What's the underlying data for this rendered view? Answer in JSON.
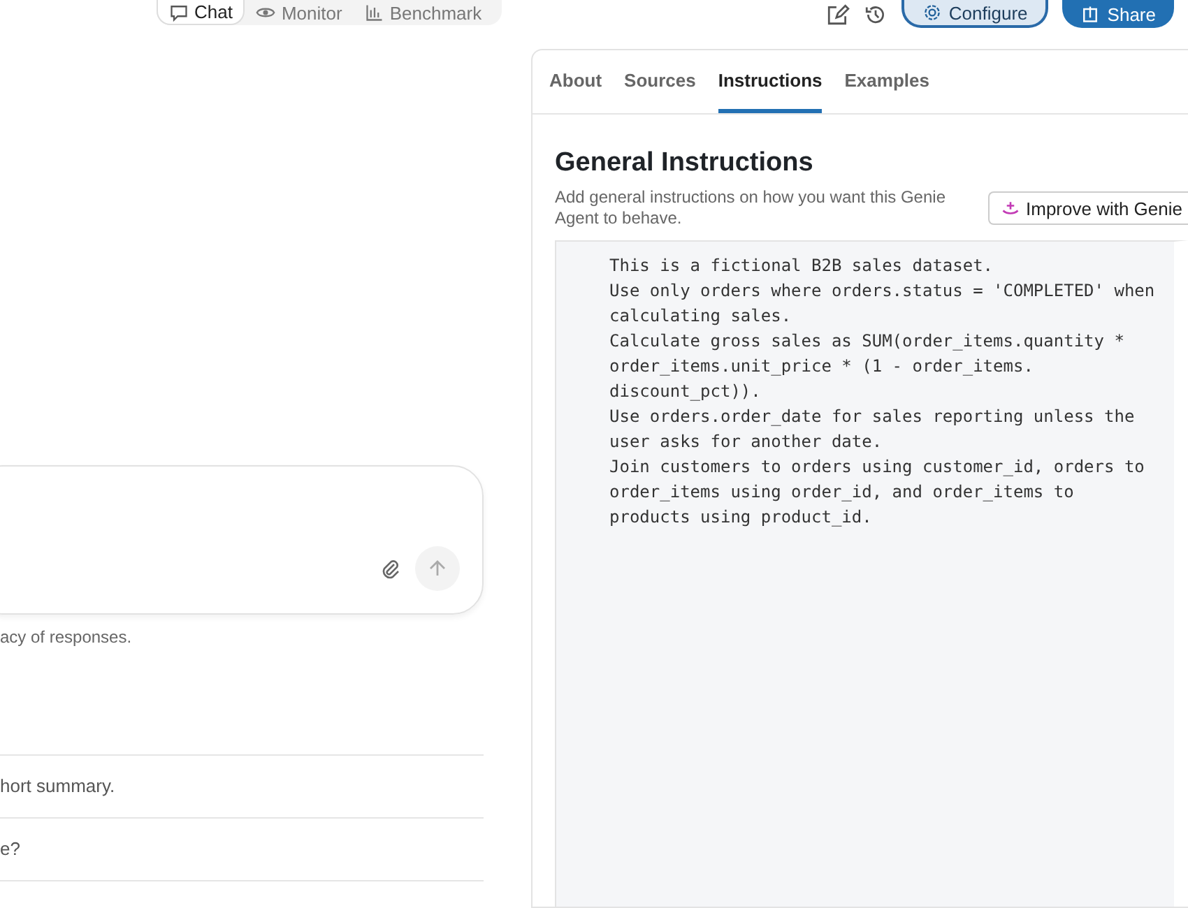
{
  "mode_tabs": [
    {
      "label": "Chat",
      "kind": "chat",
      "selected": true
    },
    {
      "label": "Monitor",
      "kind": "monitor",
      "selected": false
    },
    {
      "label": "Benchmark",
      "kind": "benchmark",
      "selected": false
    }
  ],
  "actions": [
    {
      "label": "Configure",
      "kind": "secondary"
    },
    {
      "label": "Share",
      "kind": "primary"
    }
  ],
  "chat": {
    "disclaimer": "acy of responses.",
    "suggestions": [
      "hort summary.",
      "e?"
    ]
  },
  "panel": {
    "tabs": [
      {
        "label": "About",
        "selected": false
      },
      {
        "label": "Sources",
        "selected": false
      },
      {
        "label": "Instructions",
        "selected": true
      },
      {
        "label": "Examples",
        "selected": false
      }
    ],
    "title": "General Instructions",
    "description": "Add general instructions on how you want this Genie Agent to behave.",
    "improve_button": "Improve with Genie",
    "instructions": "This is a fictional B2B sales dataset.\nUse only orders where orders.status = 'COMPLETED' when calculating sales.\nCalculate gross sales as SUM(order_items.quantity * order_items.unit_price * (1 - order_items.\ndiscount_pct)).\nUse orders.order_date for sales reporting unless the user asks for another date.\nJoin customers to orders using customer_id, orders to order_items using order_id, and order_items to products using product_id."
  }
}
